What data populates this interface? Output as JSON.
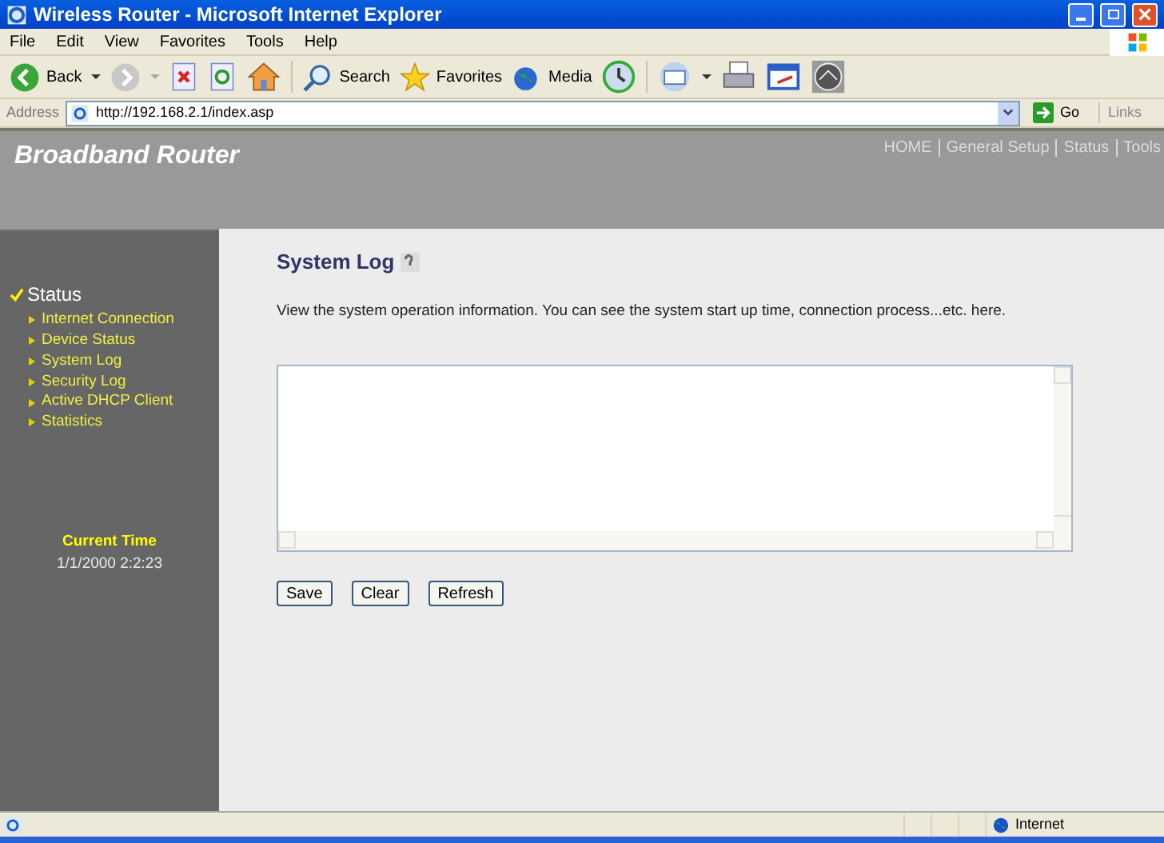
{
  "window": {
    "title": "Wireless Router - Microsoft Internet Explorer"
  },
  "menu": [
    "File",
    "Edit",
    "View",
    "Favorites",
    "Tools",
    "Help"
  ],
  "toolbar": {
    "back": "Back",
    "search": "Search",
    "favorites": "Favorites",
    "media": "Media"
  },
  "address_bar": {
    "label": "Address",
    "url": "http://192.168.2.1/index.asp",
    "go": "Go",
    "links": "Links"
  },
  "header": {
    "brand": "Broadband Router",
    "nav": [
      "HOME",
      "General Setup",
      "Status",
      "Tools"
    ]
  },
  "sidebar": {
    "section": "Status",
    "items": [
      "Internet Connection",
      "Device Status",
      "System Log",
      "Security Log",
      "Active DHCP Client",
      "Statistics"
    ],
    "time_label": "Current Time",
    "time": "1/1/2000 2:2:23"
  },
  "content": {
    "title": "System Log",
    "description": "View the system operation information. You can see the system start up time, connection process...etc. here.",
    "buttons": [
      "Save",
      "Clear",
      "Refresh"
    ]
  },
  "status_bar": {
    "zone": "Internet"
  }
}
